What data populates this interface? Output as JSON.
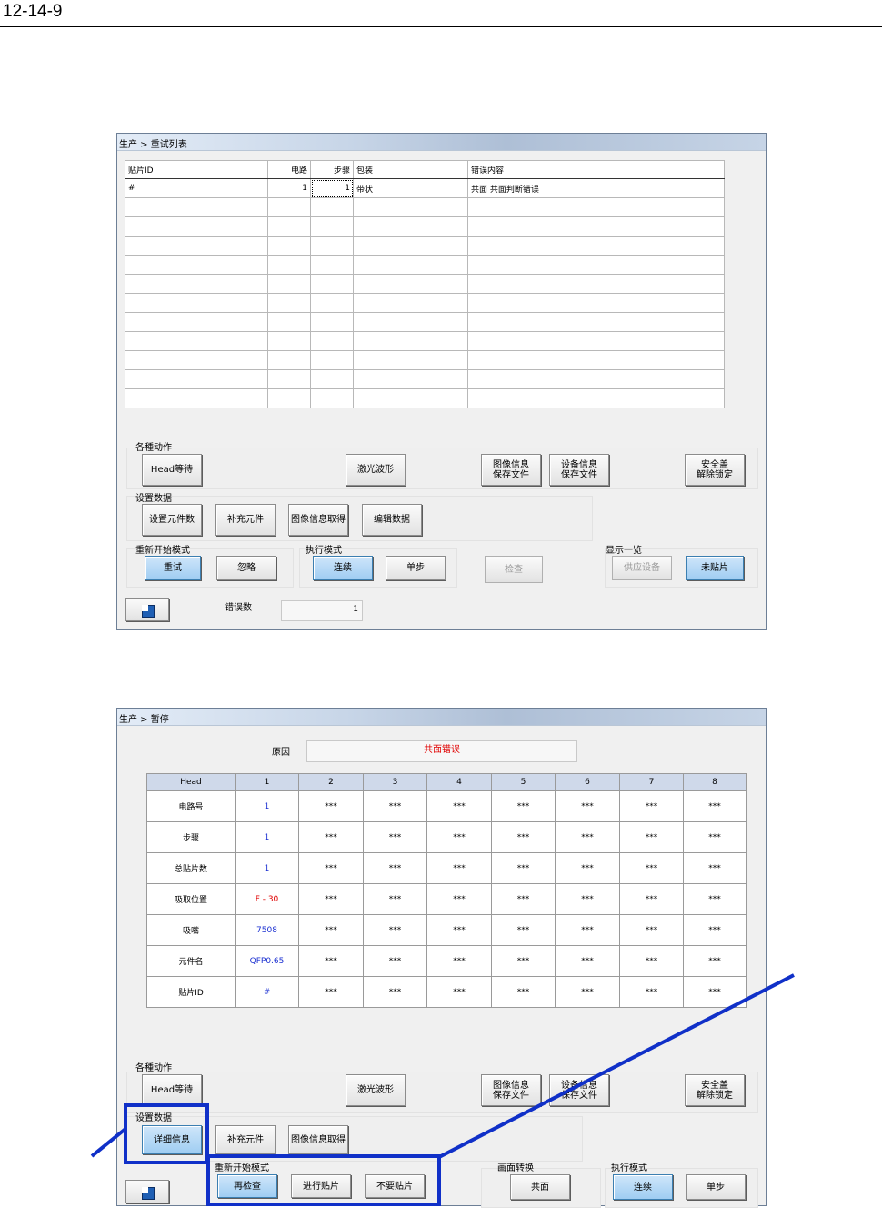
{
  "page": {
    "number": "12-14-9"
  },
  "win1": {
    "title": "生产 > 重试列表",
    "table": {
      "headers": [
        "贴片ID",
        "电路",
        "步骤",
        "包装",
        "错误内容"
      ],
      "rows": [
        [
          "#",
          "1",
          "1",
          "带状",
          "共面  共面判断错误"
        ]
      ]
    },
    "groups": {
      "actions": "各種动作",
      "setup": "设置数据",
      "restart": "重新开始模式",
      "exec": "执行模式",
      "display": "显示一览"
    },
    "buttons": {
      "head_wait": "Head等待",
      "laser": "激光波形",
      "img_save": "图像信息\n保存文件",
      "dev_save": "设备信息\n保存文件",
      "safety": "安全盖\n解除锁定",
      "set_parts": "设置元件数",
      "add_parts": "补充元件",
      "img_get": "图像信息取得",
      "edit_data": "编辑数据",
      "retry": "重试",
      "ignore": "忽略",
      "continuous": "连续",
      "single": "单步",
      "check": "检查",
      "feeder": "供应设备",
      "unplaced": "未贴片"
    },
    "error_count_label": "错误数",
    "error_count": "1"
  },
  "win2": {
    "title": "生产 > 暂停",
    "cause_label": "原因",
    "cause_value": "共面错误",
    "table": {
      "headers": [
        "Head",
        "1",
        "2",
        "3",
        "4",
        "5",
        "6",
        "7",
        "8"
      ],
      "rows": [
        {
          "label": "电路号",
          "head1": "1",
          "others": [
            "***",
            "***",
            "***",
            "***",
            "***",
            "***",
            "***"
          ]
        },
        {
          "label": "步骤",
          "head1": "1",
          "others": [
            "***",
            "***",
            "***",
            "***",
            "***",
            "***",
            "***"
          ]
        },
        {
          "label": "总贴片数",
          "head1": "1",
          "others": [
            "***",
            "***",
            "***",
            "***",
            "***",
            "***",
            "***"
          ]
        },
        {
          "label": "吸取位置",
          "head1": "F - 30",
          "others": [
            "***",
            "***",
            "***",
            "***",
            "***",
            "***",
            "***"
          ]
        },
        {
          "label": "吸嘴",
          "head1": "7508",
          "others": [
            "***",
            "***",
            "***",
            "***",
            "***",
            "***",
            "***"
          ]
        },
        {
          "label": "元件名",
          "head1": "QFP0.65",
          "others": [
            "***",
            "***",
            "***",
            "***",
            "***",
            "***",
            "***"
          ]
        },
        {
          "label": "贴片ID",
          "head1": "#",
          "others": [
            "***",
            "***",
            "***",
            "***",
            "***",
            "***",
            "***"
          ]
        }
      ]
    },
    "groups": {
      "actions": "各種动作",
      "setup": "设置数据",
      "restart": "重新开始模式",
      "screen": "画面转换",
      "exec": "执行模式"
    },
    "buttons": {
      "head_wait": "Head等待",
      "laser": "激光波形",
      "img_save": "图像信息\n保存文件",
      "dev_save": "设备信息\n保存文件",
      "safety": "安全盖\n解除锁定",
      "detail": "详细信息",
      "add_parts": "补充元件",
      "img_get": "图像信息取得",
      "recheck": "再检查",
      "do_place": "进行贴片",
      "no_place": "不要贴片",
      "coplanar": "共面",
      "continuous": "连续",
      "single": "单步"
    }
  },
  "colors": {
    "highlight": "#1030c8",
    "error_text": "#e00000",
    "value_blue": "#1a2fd1",
    "header_blue": "#cfd9ea"
  }
}
